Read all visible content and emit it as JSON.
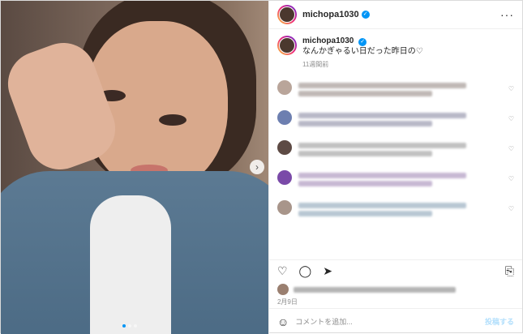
{
  "post": {
    "username": "michopa1030",
    "caption_text": "なんかぎゃるい日だった昨日の♡",
    "caption_time": "11週間前",
    "date": "2月9日"
  },
  "header": {
    "more_label": "···"
  },
  "actions": {
    "like_icon": "heart-icon",
    "comment_icon": "comment-icon",
    "share_icon": "share-icon",
    "save_icon": "bookmark-icon"
  },
  "add_comment": {
    "placeholder": "コメントを追加...",
    "post_label": "投稿する"
  },
  "media": {
    "next_label": "›",
    "image_count": 3,
    "current_image": 1
  },
  "comments": [
    {
      "avatar_color": "#b9a59a",
      "line_color": "#8c7f7a"
    },
    {
      "avatar_color": "#6d7fb0",
      "line_color": "#7f7f9a"
    },
    {
      "avatar_color": "#5d4a44",
      "line_color": "#8f8f8f"
    },
    {
      "avatar_color": "#7a4aa8",
      "line_color": "#9a7fb0"
    },
    {
      "avatar_color": "#a8958a",
      "line_color": "#7f9ab0"
    }
  ]
}
